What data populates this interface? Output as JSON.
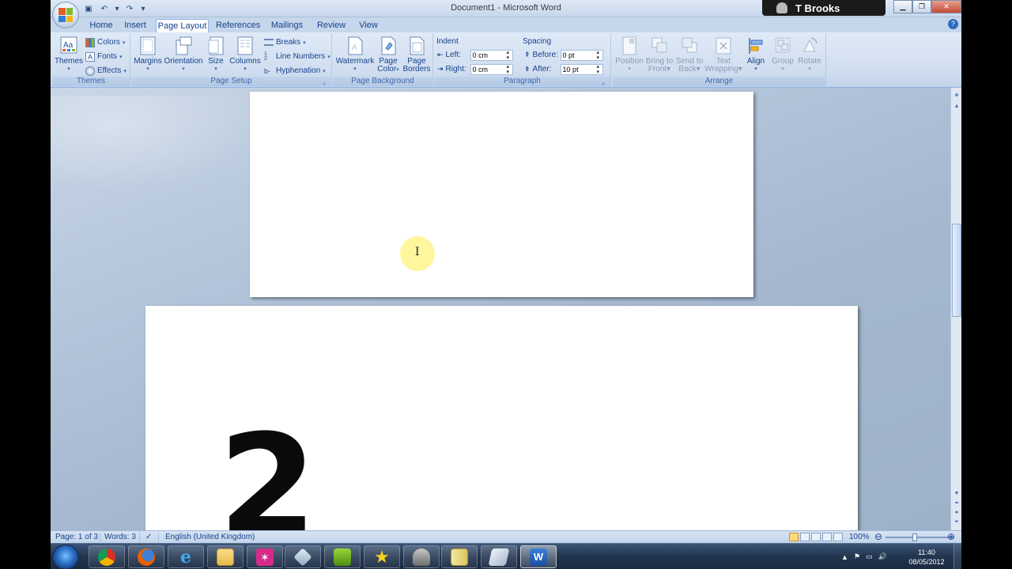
{
  "window": {
    "title": "Document1 - Microsoft Word",
    "user": "T Brooks"
  },
  "tabs": [
    {
      "label": "Home",
      "active": false
    },
    {
      "label": "Insert",
      "active": false
    },
    {
      "label": "Page Layout",
      "active": true
    },
    {
      "label": "References",
      "active": false
    },
    {
      "label": "Mailings",
      "active": false
    },
    {
      "label": "Review",
      "active": false
    },
    {
      "label": "View",
      "active": false
    }
  ],
  "ribbon": {
    "themes": {
      "label": "Themes",
      "themes_btn": "Themes",
      "colors": "Colors",
      "fonts": "Fonts",
      "effects": "Effects"
    },
    "page_setup": {
      "label": "Page Setup",
      "margins": "Margins",
      "orientation": "Orientation",
      "size": "Size",
      "columns": "Columns",
      "breaks": "Breaks",
      "line_numbers": "Line Numbers",
      "hyphenation": "Hyphenation"
    },
    "page_background": {
      "label": "Page Background",
      "watermark": "Watermark",
      "page_color_1": "Page",
      "page_color_2": "Color",
      "page_borders_1": "Page",
      "page_borders_2": "Borders"
    },
    "paragraph": {
      "label": "Paragraph",
      "indent_heading": "Indent",
      "left_label": "Left:",
      "left_value": "0 cm",
      "right_label": "Right:",
      "right_value": "0 cm",
      "spacing_heading": "Spacing",
      "before_label": "Before:",
      "before_value": "0 pt",
      "after_label": "After:",
      "after_value": "10 pt"
    },
    "arrange": {
      "label": "Arrange",
      "position": "Position",
      "bring_front_1": "Bring to",
      "bring_front_2": "Front",
      "send_back_1": "Send to",
      "send_back_2": "Back",
      "text_wrap_1": "Text",
      "text_wrap_2": "Wrapping",
      "align": "Align",
      "group": "Group",
      "rotate": "Rotate"
    }
  },
  "document": {
    "page2_text": "2"
  },
  "statusbar": {
    "page": "Page: 1 of 3",
    "words": "Words: 3",
    "language": "English (United Kingdom)",
    "zoom": "100%"
  },
  "taskbar": {
    "time": "11:40",
    "date": "08/05/2012"
  },
  "colors": {
    "ribbon_text": "#15428b",
    "office_blue": "#2e6cc0",
    "highlight": "#fff58c"
  }
}
